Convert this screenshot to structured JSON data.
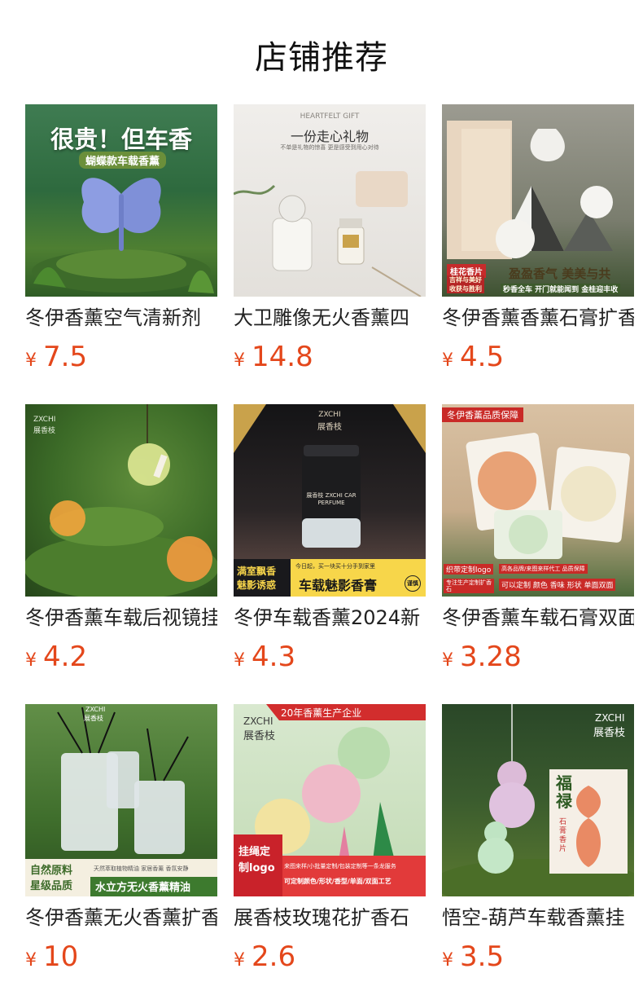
{
  "page": {
    "title": "店铺推荐"
  },
  "currency": "¥",
  "products": [
    {
      "name": "冬伊香薰空气清新剂",
      "price": "7.5",
      "image": {
        "headline": "很贵！但车香",
        "subline": "蝴蝶款车载香薰"
      },
      "colors": {
        "top": "#2f6b45",
        "bottom": "#3d7a2e",
        "accent": "#8a9be0"
      }
    },
    {
      "name": "大卫雕像无火香薰四",
      "price": "14.8",
      "image": {
        "small": "HEARTFELT GIFT",
        "headline": "一份走心礼物",
        "subline": "不单是礼物的惊喜 更是感受到用心对待"
      },
      "colors": {
        "top": "#e9e7e3",
        "bottom": "#d8d4cf",
        "accent": "#c9a24b"
      }
    },
    {
      "name": "冬伊香薰香薰石膏扩香",
      "price": "4.5",
      "image": {
        "badge": "桂花香片",
        "badge_sub1": "吉祥与美好",
        "badge_sub2": "收获与胜利",
        "headline": "盈盈香气 美美与共",
        "subline": "秒香全车 开门就能闻到 金桂迎丰收"
      },
      "colors": {
        "top": "#8c8d84",
        "bottom": "#4b5e3b",
        "accent": "#c62b2b"
      }
    },
    {
      "name": "冬伊香薰车载后视镜挂",
      "price": "4.2",
      "image": {
        "brand_en": "ZXCHI",
        "brand_cn": "展香枝"
      },
      "colors": {
        "top": "#3f6b2d",
        "bottom": "#2c4d1e",
        "accent": "#f29a3a"
      }
    },
    {
      "name": "冬伊车载香薰2024新",
      "price": "4.3",
      "image": {
        "brand_en": "ZXCHI",
        "brand_cn": "展香枝",
        "product_label": "展香枝 ZXCHI CAR PERFUME",
        "left_text1": "满室飘香",
        "left_text2": "魅影诱惑",
        "small": "今日起，买一块买十分手到家里",
        "headline": "车载魅影香膏",
        "seal": "谨慎"
      },
      "colors": {
        "top": "#1b1b1f",
        "bottom": "#5a4a44",
        "accent": "#f3d24a"
      }
    },
    {
      "name": "冬伊香薰车载石膏双面",
      "price": "3.28",
      "image": {
        "top_banner": "冬伊香薰品质保障",
        "left_tag1": "织带定制logo",
        "left_tag2": "专注生产定制扩香石",
        "right_tag1": "高各品牌/来图来样代工 品质保障",
        "right_tag2": "可以定制 颜色 香味 形状 单面双面"
      },
      "colors": {
        "top": "#dcc5a7",
        "bottom": "#4d6b3b",
        "accent": "#c92a27"
      }
    },
    {
      "name": "冬伊香薰无火香薰扩香",
      "price": "10",
      "image": {
        "brand_en": "ZXCHI",
        "brand_cn": "展香枝",
        "left_text1": "自然原料",
        "left_text2": "星级品质",
        "small": "天然萃取植物精油 家居香薰 香氛安静",
        "headline": "水立方无火香薰精油"
      },
      "colors": {
        "top": "#4f7c3a",
        "bottom": "#2d5a22",
        "accent": "#e6c14a"
      }
    },
    {
      "name": "展香枝玫瑰花扩香石",
      "price": "2.6",
      "image": {
        "top_banner": "20年香薰生产企业",
        "brand_en": "ZXCHI",
        "brand_cn": "展香枝",
        "left_tag1": "挂绳定",
        "left_tag2": "制logo",
        "strip1": "来图来样/小批量定制/包装定制等一条龙服务",
        "strip2": "可定制颜色/形状/香型/单面/双面工艺"
      },
      "colors": {
        "top": "#cfe2c6",
        "bottom": "#b7d3a8",
        "accent": "#d22d2d"
      }
    },
    {
      "name": "悟空-葫芦车载香薰挂",
      "price": "3.5",
      "image": {
        "brand_en": "ZXCHI",
        "brand_cn": "展香枝",
        "headline": "福禄",
        "subline": "石膏香片"
      },
      "colors": {
        "top": "#2c4a2a",
        "bottom": "#55752f",
        "accent": "#e38a6a"
      }
    }
  ]
}
